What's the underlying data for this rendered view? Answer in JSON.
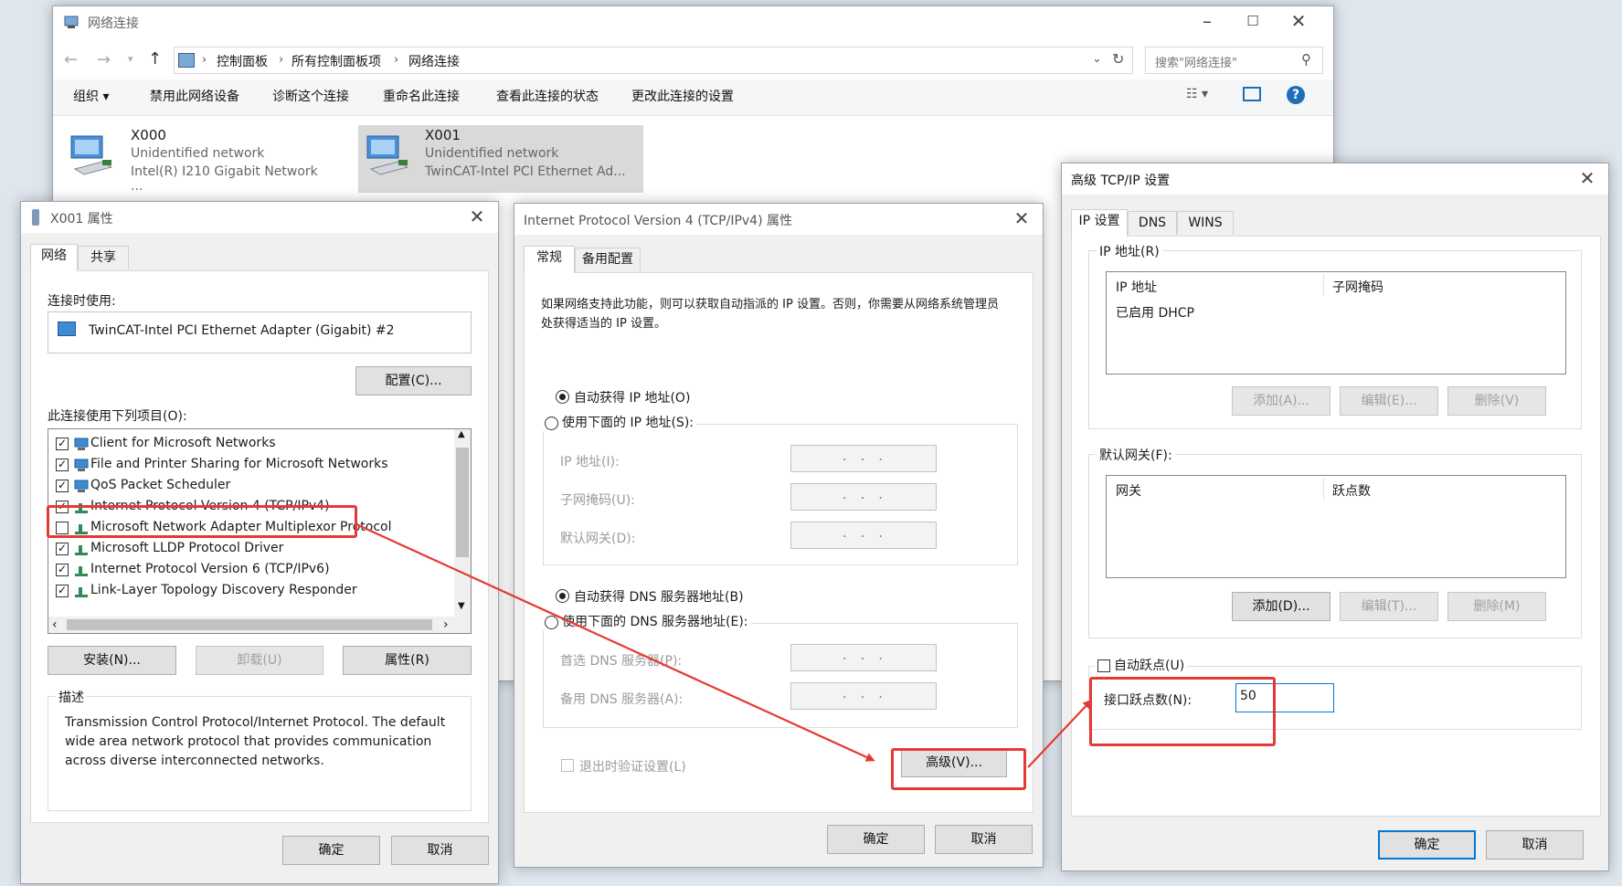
{
  "explorer": {
    "title": "网络连接",
    "breadcrumb": [
      "控制面板",
      "所有控制面板项",
      "网络连接"
    ],
    "search_placeholder": "搜索\"网络连接\"",
    "toolbar": {
      "organize": "组织 ▾",
      "disable": "禁用此网络设备",
      "diagnose": "诊断这个连接",
      "rename": "重命名此连接",
      "status": "查看此连接的状态",
      "change": "更改此连接的设置"
    },
    "connections": [
      {
        "name": "X000",
        "status": "Unidentified network",
        "adapter": "Intel(R) I210 Gigabit Network ..."
      },
      {
        "name": "X001",
        "status": "Unidentified network",
        "adapter": "TwinCAT-Intel PCI Ethernet Ad..."
      }
    ]
  },
  "props": {
    "title": "X001 属性",
    "tabs": [
      "网络",
      "共享"
    ],
    "connect_using_label": "连接时使用:",
    "adapter": "TwinCAT-Intel PCI Ethernet Adapter (Gigabit) #2",
    "configure": "配置(C)...",
    "items_label": "此连接使用下列项目(O):",
    "items": [
      {
        "label": "Client for Microsoft Networks",
        "checked": true
      },
      {
        "label": "File and Printer Sharing for Microsoft Networks",
        "checked": true
      },
      {
        "label": "QoS Packet Scheduler",
        "checked": true
      },
      {
        "label": "Internet Protocol Version 4 (TCP/IPv4)",
        "checked": true
      },
      {
        "label": "Microsoft Network Adapter Multiplexor Protocol",
        "checked": false
      },
      {
        "label": "Microsoft LLDP Protocol Driver",
        "checked": true
      },
      {
        "label": "Internet Protocol Version 6 (TCP/IPv6)",
        "checked": true
      },
      {
        "label": "Link-Layer Topology Discovery Responder",
        "checked": true
      }
    ],
    "install": "安装(N)...",
    "uninstall": "卸载(U)",
    "properties": "属性(R)",
    "desc_title": "描述",
    "description": "Transmission Control Protocol/Internet Protocol. The default wide area network protocol that provides communication across diverse interconnected networks.",
    "ok": "确定",
    "cancel": "取消"
  },
  "ipv4": {
    "title": "Internet Protocol Version 4 (TCP/IPv4) 属性",
    "tabs": [
      "常规",
      "备用配置"
    ],
    "intro": "如果网络支持此功能，则可以获取自动指派的 IP 设置。否则，你需要从网络系统管理员处获得适当的 IP 设置。",
    "auto_ip": "自动获得 IP 地址(O)",
    "manual_ip": "使用下面的 IP 地址(S):",
    "ip_label": "IP 地址(I):",
    "mask_label": "子网掩码(U):",
    "gateway_label": "默认网关(D):",
    "auto_dns": "自动获得 DNS 服务器地址(B)",
    "manual_dns": "使用下面的 DNS 服务器地址(E):",
    "dns1_label": "首选 DNS 服务器(P):",
    "dns2_label": "备用 DNS 服务器(A):",
    "ip_blank": ".   .   .",
    "validate": "退出时验证设置(L)",
    "advanced": "高级(V)...",
    "ok": "确定",
    "cancel": "取消"
  },
  "adv": {
    "title": "高级 TCP/IP 设置",
    "tabs": [
      "IP 设置",
      "DNS",
      "WINS"
    ],
    "ip_group": "IP 地址(R)",
    "ip_col1": "IP 地址",
    "ip_col2": "子网掩码",
    "ip_row": "已启用 DHCP",
    "add": "添加(A)...",
    "edit": "编辑(E)...",
    "delete": "删除(V)",
    "gw_group": "默认网关(F):",
    "gw_col1": "网关",
    "gw_col2": "跃点数",
    "gw_add": "添加(D)...",
    "gw_edit": "编辑(T)...",
    "gw_delete": "删除(M)",
    "auto_metric": "自动跃点(U)",
    "metric_label": "接口跃点数(N):",
    "metric_value": "50",
    "ok": "确定",
    "cancel": "取消"
  },
  "colors": {
    "highlight": "#e53935",
    "accent": "#0078d7"
  }
}
